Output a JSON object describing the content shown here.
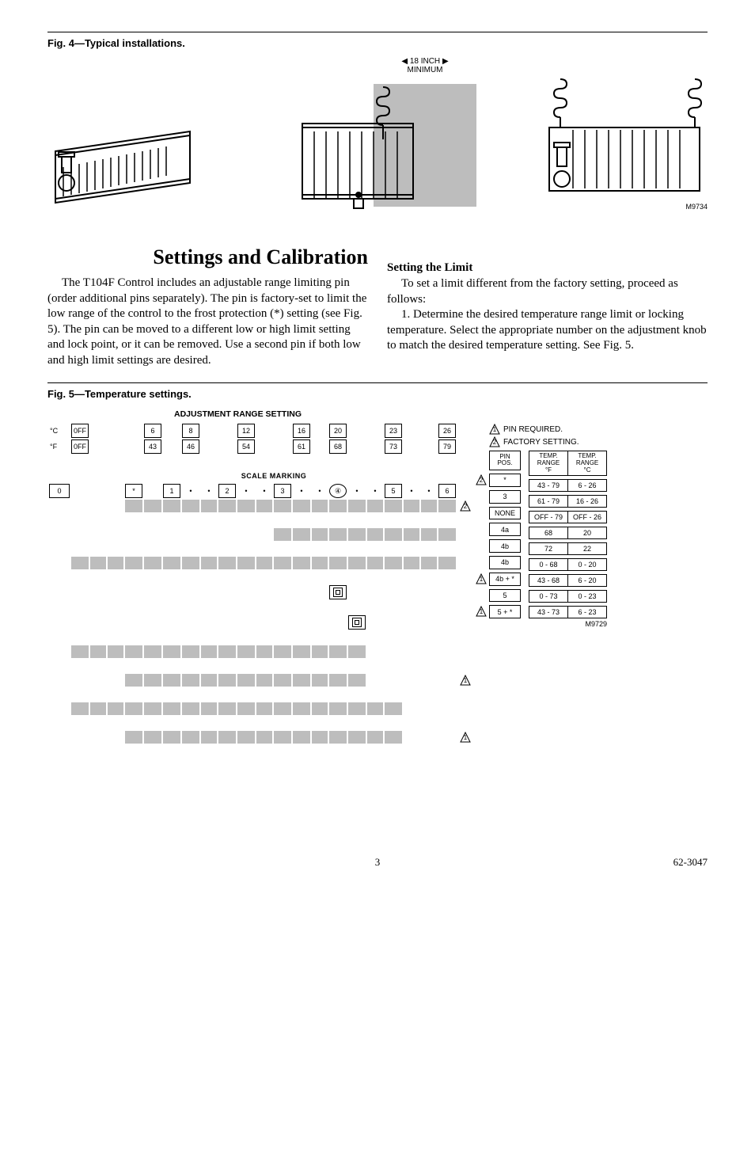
{
  "fig4_caption": "Fig. 4—Typical installations.",
  "clearance_dim": "18 INCH",
  "clearance_word": "MINIMUM",
  "mref_fig4": "M9734",
  "section_title": "Settings and Calibration",
  "left_para": "The T104F Control includes an adjustable range limiting pin (order additional pins separately). The pin is factory-set to limit the low range of the control to the frost protection (*) setting (see Fig. 5). The pin can be moved to a different low or high limit setting and lock point, or it can be removed. Use a second pin if both low and high limit settings are desired.",
  "right_sub": "Setting the Limit",
  "right_p1": "To set a limit different from the factory setting, proceed as follows:",
  "right_p2": "1. Determine the desired temperature range limit or locking temperature. Select the appropriate number on the adjustment knob to match the desired temperature setting. See Fig. 5.",
  "fig5_caption": "Fig. 5—Temperature settings.",
  "adj_title": "ADJUSTMENT RANGE SETTING",
  "scale_marking": "SCALE MARKING",
  "rowC_label": "°C",
  "rowF_label": "°F",
  "rowC": [
    "0FF",
    "",
    "",
    "",
    "6",
    "",
    "8",
    "",
    "",
    "12",
    "",
    "",
    "16",
    "",
    "20",
    "",
    "",
    "23",
    "",
    "",
    "26"
  ],
  "rowF": [
    "0FF",
    "",
    "",
    "",
    "43",
    "",
    "46",
    "",
    "",
    "54",
    "",
    "",
    "61",
    "",
    "68",
    "",
    "",
    "73",
    "",
    "",
    "79"
  ],
  "scale_row": [
    "0",
    "",
    "",
    "",
    "*",
    "",
    "1",
    "•",
    "•",
    "2",
    "•",
    "•",
    "3",
    "•",
    "•",
    "④",
    "•",
    "•",
    "5",
    "•",
    "•",
    "6"
  ],
  "legend_pin": "PIN REQUIRED.",
  "legend_factory": "FACTORY SETTING.",
  "pin_hdr": "PIN\nPOS.",
  "rangeF_hdr": "TEMP.\nRANGE\n°F",
  "rangeC_hdr": "TEMP.\nRANGE\n°C",
  "rows": [
    {
      "pin": "*",
      "f": "43 - 79",
      "c": "6 - 26",
      "tri": "2"
    },
    {
      "pin": "3",
      "f": "61 - 79",
      "c": "16 - 26"
    },
    {
      "pin": "NONE",
      "f": "OFF - 79",
      "c": "OFF - 26"
    },
    {
      "pin": "4a",
      "f": "68",
      "c": "20"
    },
    {
      "pin": "4b",
      "f": "72",
      "c": "22"
    },
    {
      "pin": "4b",
      "f": "0 - 68",
      "c": "0 - 20"
    },
    {
      "pin": "4b + *",
      "f": "43 - 68",
      "c": "6 - 20",
      "tri": "1"
    },
    {
      "pin": "5",
      "f": "0 - 73",
      "c": "0 - 23"
    },
    {
      "pin": "5 + *",
      "f": "43 - 73",
      "c": "6 - 23",
      "tri": "1"
    }
  ],
  "mref_fig5": "M9729",
  "page_num": "3",
  "doc_num": "62-3047"
}
